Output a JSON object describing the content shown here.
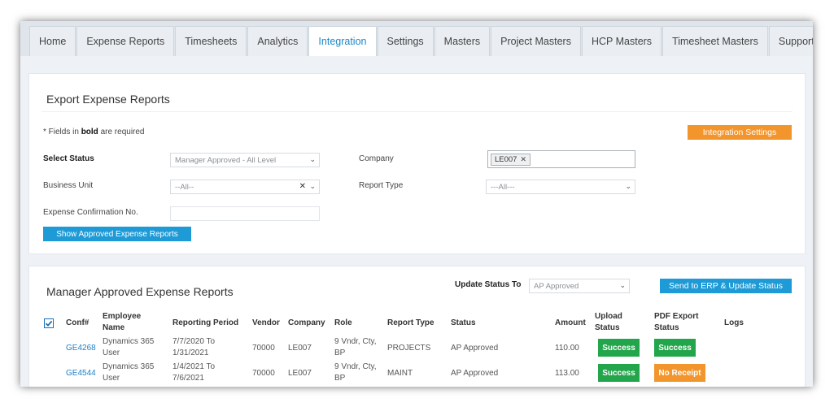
{
  "tabs": [
    {
      "label": "Home"
    },
    {
      "label": "Expense Reports"
    },
    {
      "label": "Timesheets"
    },
    {
      "label": "Analytics"
    },
    {
      "label": "Integration"
    },
    {
      "label": "Settings"
    },
    {
      "label": "Masters"
    },
    {
      "label": "Project Masters"
    },
    {
      "label": "HCP Masters"
    },
    {
      "label": "Timesheet Masters"
    },
    {
      "label": "Support"
    }
  ],
  "active_tab": "Integration",
  "export": {
    "title": "Export Expense Reports",
    "note_prefix": "* Fields in ",
    "note_bold": "bold",
    "note_suffix": " are required",
    "integration_settings_label": "Integration Settings",
    "select_status_label": "Select Status",
    "select_status_value": "Manager Approved - All Level",
    "company_label": "Company",
    "company_chip": "LE007",
    "business_unit_label": "Business Unit",
    "business_unit_value": "--All--",
    "report_type_label": "Report Type",
    "report_type_value": "---All---",
    "confirmation_label": "Expense Confirmation No.",
    "confirmation_value": "",
    "show_button_label": "Show Approved Expense Reports"
  },
  "approved": {
    "title": "Manager Approved Expense Reports",
    "update_status_label": "Update Status To",
    "update_status_value": "AP Approved",
    "send_button_label": "Send to ERP & Update Status",
    "headers": {
      "conf": "Conf#",
      "employee": "Employee Name",
      "period": "Reporting Period",
      "vendor": "Vendor",
      "company": "Company",
      "role": "Role",
      "report_type": "Report Type",
      "status": "Status",
      "amount": "Amount",
      "upload": "Upload Status",
      "pdf": "PDF Export Status",
      "logs": "Logs"
    },
    "rows": [
      {
        "conf": "GE4268",
        "employee": "Dynamics 365 User",
        "period": "7/7/2020 To 1/31/2021",
        "vendor": "70000",
        "company": "LE007",
        "role": "9 Vndr, Cty, BP",
        "report_type": "PROJECTS",
        "status": "AP Approved",
        "amount": "110.00",
        "upload": "Success",
        "pdf": "Success"
      },
      {
        "conf": "GE4544",
        "employee": "Dynamics 365 User",
        "period": "1/4/2021 To 7/6/2021",
        "vendor": "70000",
        "company": "LE007",
        "role": "9 Vndr, Cty, BP",
        "report_type": "MAINT",
        "status": "AP Approved",
        "amount": "113.00",
        "upload": "Success",
        "pdf": "No Receipt"
      }
    ]
  },
  "colors": {
    "accent_blue": "#1e9ad6",
    "accent_orange": "#f3952d",
    "success_green": "#22a54b"
  }
}
